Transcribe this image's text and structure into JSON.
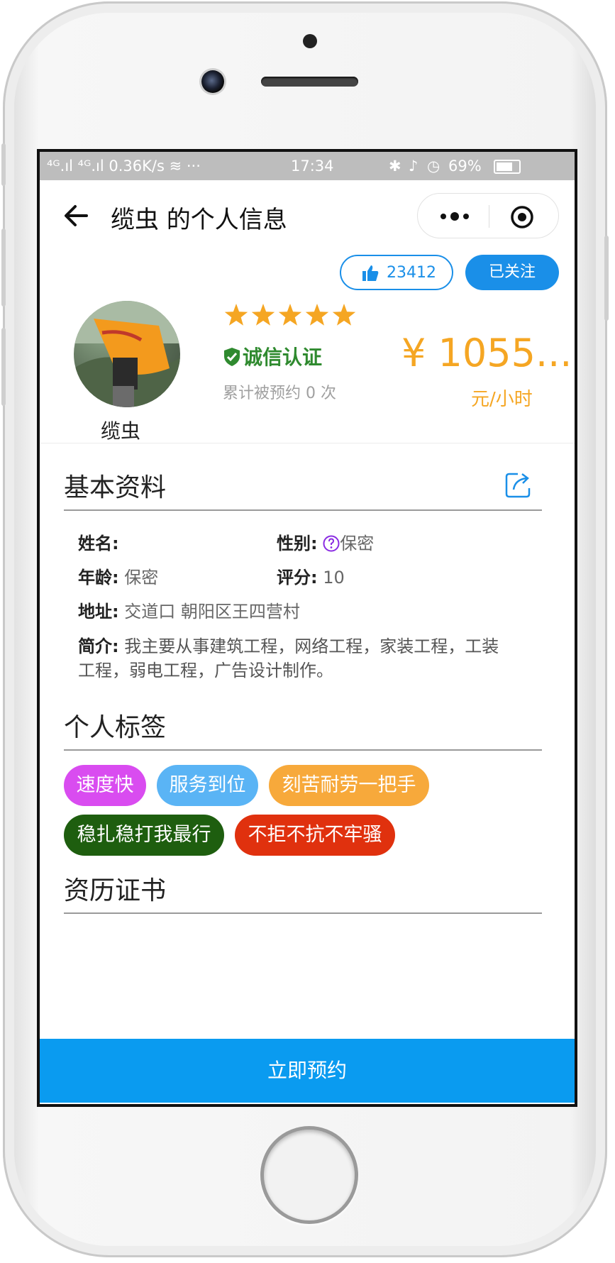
{
  "status_bar": {
    "left": "⁴ᴳ.ıl ⁴ᴳ.ıl 0.36K/s ≋ ···",
    "time": "17:34",
    "battery": "69%"
  },
  "nav": {
    "title": "缆虫 的个人信息"
  },
  "actions": {
    "like_count": "23412",
    "follow_label": "已关注"
  },
  "profile": {
    "name": "缆虫",
    "rating_stars": 5,
    "credit_label": "诚信认证",
    "booked_text": "累计被预约 0 次",
    "price": "¥ 1055...",
    "price_unit": "元/小时"
  },
  "basic_info": {
    "title": "基本资料",
    "name_label": "姓名:",
    "name_value": "",
    "gender_label": "性别:",
    "gender_value": "保密",
    "age_label": "年龄:",
    "age_value": "保密",
    "score_label": "评分:",
    "score_value": "10",
    "address_label": "地址:",
    "address_value": "交道口 朝阳区王四营村",
    "intro_label": "简介:",
    "intro_value": "我主要从事建筑工程，网络工程，家装工程，工装工程，弱电工程，广告设计制作。"
  },
  "tags": {
    "title": "个人标签",
    "items": [
      {
        "label": "速度快",
        "color": "#d94cf0"
      },
      {
        "label": "服务到位",
        "color": "#5ab4f5"
      },
      {
        "label": "刻苦耐劳一把手",
        "color": "#f7a93b"
      },
      {
        "label": "稳扎稳打我最行",
        "color": "#1e5e0f"
      },
      {
        "label": "不拒不抗不牢骚",
        "color": "#e0310e"
      }
    ]
  },
  "certificates": {
    "title": "资历证书"
  },
  "bottom": {
    "book_button": "立即预约"
  },
  "colors": {
    "accent": "#1a8fe8",
    "price": "#f5a623",
    "credit": "#2f8a2f",
    "star": "#f5a623"
  }
}
